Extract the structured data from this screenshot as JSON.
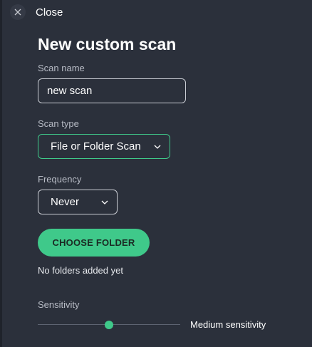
{
  "close": {
    "label": "Close",
    "icon": "close-icon"
  },
  "title": "New custom scan",
  "scan_name": {
    "label": "Scan name",
    "value": "new scan",
    "placeholder": ""
  },
  "scan_type": {
    "label": "Scan type",
    "selected": "File or Folder Scan"
  },
  "frequency": {
    "label": "Frequency",
    "selected": "Never"
  },
  "choose_folder": {
    "label": "CHOOSE FOLDER"
  },
  "folders": {
    "empty_text": "No folders added yet"
  },
  "sensitivity": {
    "label": "Sensitivity",
    "value_text": "Medium sensitivity",
    "level_fraction": 0.5
  },
  "colors": {
    "accent": "#3fc98a",
    "background": "#2b303b",
    "label": "#b8bcc6"
  }
}
